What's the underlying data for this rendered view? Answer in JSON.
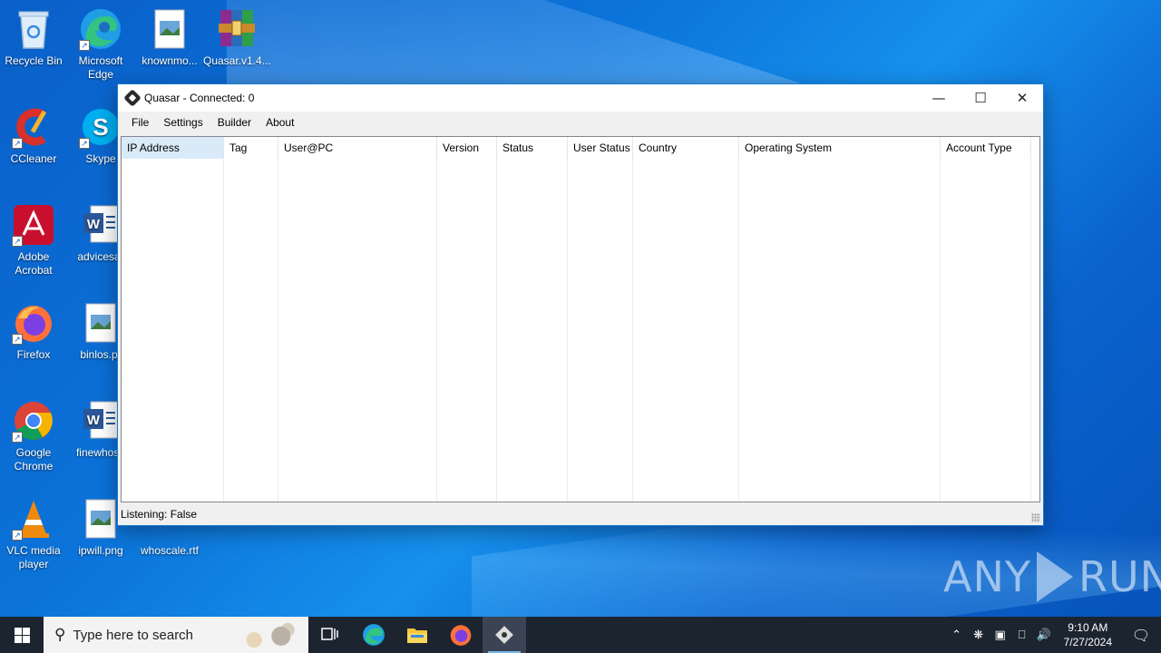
{
  "desktop": {
    "icons": [
      {
        "label": "Recycle Bin",
        "icon": "recycle-bin-icon"
      },
      {
        "label": "Microsoft Edge",
        "icon": "edge-icon"
      },
      {
        "label": "knownmo...",
        "icon": "image-file-icon"
      },
      {
        "label": "Quasar.v1.4....",
        "icon": "winrar-archive-icon"
      },
      {
        "label": "CCleaner",
        "icon": "ccleaner-icon"
      },
      {
        "label": "Skype",
        "icon": "skype-icon"
      },
      {
        "label": "Adobe Acrobat",
        "icon": "acrobat-icon"
      },
      {
        "label": "advicesar",
        "icon": "word-doc-icon"
      },
      {
        "label": "Firefox",
        "icon": "firefox-icon"
      },
      {
        "label": "binlos.pr",
        "icon": "image-file-icon"
      },
      {
        "label": "Google Chrome",
        "icon": "chrome-icon"
      },
      {
        "label": "finewhose",
        "icon": "word-doc-icon"
      },
      {
        "label": "VLC media player",
        "icon": "vlc-icon"
      },
      {
        "label": "ipwill.png",
        "icon": "image-file-icon"
      },
      {
        "label": "whoscale.rtf",
        "icon": "rtf-file-icon"
      }
    ]
  },
  "window": {
    "title": "Quasar - Connected: 0",
    "controls": {
      "minimize": "—",
      "maximize": "☐",
      "close": "✕"
    },
    "menu": [
      "File",
      "Settings",
      "Builder",
      "About"
    ],
    "columns": [
      "IP Address",
      "Tag",
      "User@PC",
      "Version",
      "Status",
      "User Status",
      "Country",
      "Operating System",
      "Account Type"
    ],
    "status": "Listening: False"
  },
  "taskbar": {
    "search_placeholder": "Type here to search",
    "time": "9:10 AM",
    "date": "7/27/2024",
    "active_app": "Quasar"
  },
  "watermark": {
    "left": "ANY",
    "right": "RUN"
  }
}
